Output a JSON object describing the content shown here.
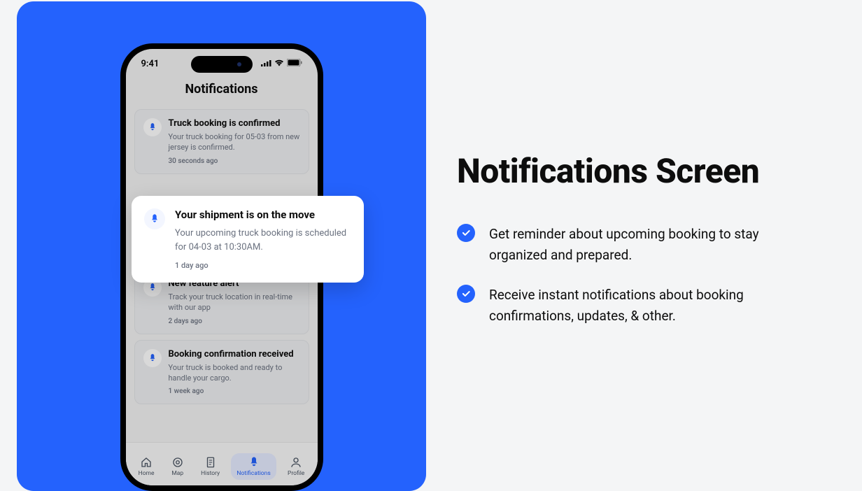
{
  "marketing": {
    "headline": "Notifications Screen",
    "bullets": [
      "Get reminder about upcoming booking to stay organized and prepared.",
      "Receive instant notifications about booking confirmations, updates, & other."
    ]
  },
  "phone": {
    "time": "9:41",
    "page_title": "Notifications",
    "bottom_nav": [
      {
        "label": "Home"
      },
      {
        "label": "Map"
      },
      {
        "label": "History"
      },
      {
        "label": "Notifications"
      },
      {
        "label": "Profile"
      }
    ],
    "notifications": [
      {
        "title": "Truck booking is confirmed",
        "body": "Your truck booking for 05-03 from new jersey is confirmed.",
        "time": "30 seconds ago"
      },
      {
        "title": "Your shipment is on the move",
        "body": "Your upcoming truck booking is scheduled for 04-03 at 10:30AM.",
        "time": "1 day ago"
      },
      {
        "title": "New feature alert",
        "body": "Track your truck location in real-time with our app",
        "time": "2 days ago"
      },
      {
        "title": "Booking confirmation received",
        "body": "Your truck is booked and ready to handle your cargo.",
        "time": "1 week ago"
      }
    ],
    "popout": {
      "title": "Your shipment is on the move",
      "body": "Your upcoming truck booking is scheduled for 04-03 at 10:30AM.",
      "time": "1 day ago"
    }
  },
  "colors": {
    "primary": "#2462fd"
  }
}
